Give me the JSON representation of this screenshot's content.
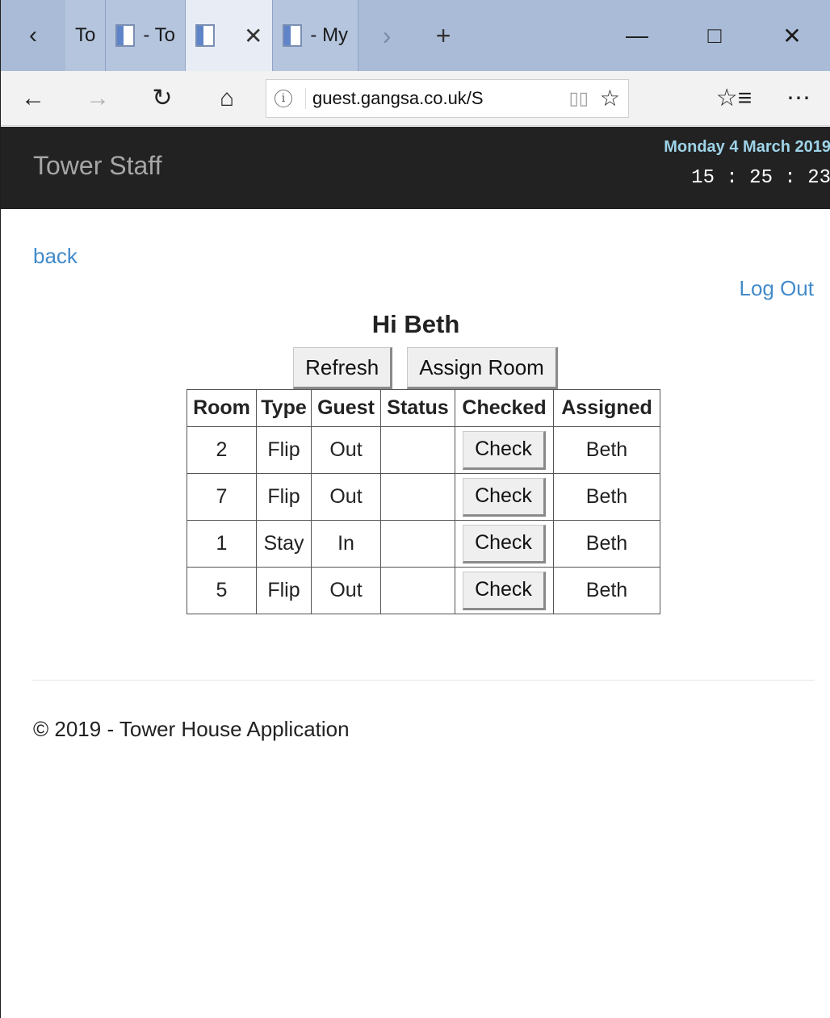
{
  "browser": {
    "tabs": [
      {
        "label": "To",
        "active": false
      },
      {
        "label": "- To",
        "active": false
      },
      {
        "label": "",
        "active": true
      },
      {
        "label": "- My",
        "active": false
      }
    ],
    "address_url": "guest.gangsa.co.uk/S"
  },
  "header": {
    "brand": "Tower Staff",
    "date": "Monday 4 March 2019",
    "time": "15 : 25 : 23"
  },
  "nav": {
    "back_label": "back",
    "logout_label": "Log Out"
  },
  "main": {
    "greeting": "Hi Beth",
    "refresh_label": "Refresh",
    "assign_room_label": "Assign Room",
    "table": {
      "headers": [
        "Room",
        "Type",
        "Guest",
        "Status",
        "Checked",
        "Assigned"
      ],
      "rows": [
        {
          "room": "2",
          "type": "Flip",
          "guest": "Out",
          "status": "",
          "checked": "Check",
          "assigned": "Beth"
        },
        {
          "room": "7",
          "type": "Flip",
          "guest": "Out",
          "status": "",
          "checked": "Check",
          "assigned": "Beth"
        },
        {
          "room": "1",
          "type": "Stay",
          "guest": "In",
          "status": "",
          "checked": "Check",
          "assigned": "Beth"
        },
        {
          "room": "5",
          "type": "Flip",
          "guest": "Out",
          "status": "",
          "checked": "Check",
          "assigned": "Beth"
        }
      ]
    }
  },
  "footer": {
    "text": "© 2019 - Tower House Application"
  },
  "colors": {
    "navbar_bg": "#222222",
    "link": "#428bca",
    "date_text": "#9ed3e8",
    "tabstrip_bg": "#a9bbd6"
  }
}
